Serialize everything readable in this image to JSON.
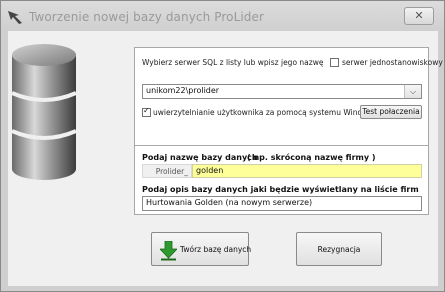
{
  "window": {
    "title": "Tworzenie nowej bazy danych ProLider",
    "close_label": "✕"
  },
  "server": {
    "prompt": "Wybierz serwer SQL z listy lub wpisz jego nazwę",
    "standalone_label": "serwer jednostanowiskowy",
    "standalone_checked": false,
    "value": "unikom22\\prolider",
    "windows_auth_label": "uwierzytelnianie użytkownika za pomocą systemu Windows",
    "windows_auth_checked": true,
    "test_button": "Test połaczenia"
  },
  "database": {
    "name_prompt": "Podaj nazwę bazy danych",
    "name_hint": "( np. skróconą nazwę firmy )",
    "prefix": "Prolider_",
    "name_value": "golden",
    "desc_prompt": "Podaj opis bazy danych jaki będzie wyświetlany na liście firm",
    "desc_value": "Hurtowania Golden (na nowym serwerze)"
  },
  "buttons": {
    "create": "Twórz bazę danych",
    "cancel": "Rezygnacja"
  },
  "icons": {
    "app": "wing-arrow-icon",
    "database": "database-cylinder-icon",
    "create": "green-down-arrow-icon"
  },
  "colors": {
    "highlight_input": "#ffff99",
    "create_arrow": "#2e9a2e"
  }
}
